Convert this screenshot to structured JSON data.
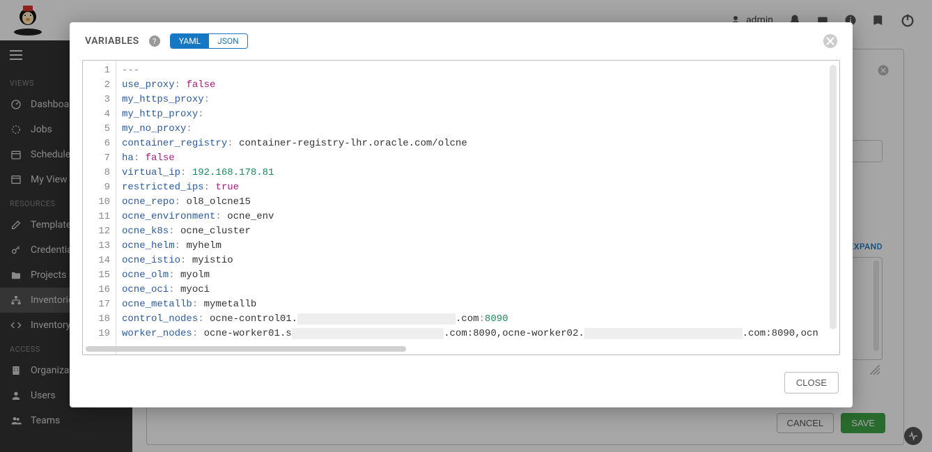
{
  "topbar": {
    "username": "admin"
  },
  "sidebar": {
    "sections": [
      {
        "label": "VIEWS",
        "items": [
          {
            "icon": "dashboard",
            "label": "Dashboard"
          },
          {
            "icon": "jobs",
            "label": "Jobs"
          },
          {
            "icon": "calendar",
            "label": "Schedules"
          },
          {
            "icon": "window",
            "label": "My View"
          }
        ]
      },
      {
        "label": "RESOURCES",
        "items": [
          {
            "icon": "edit",
            "label": "Templates"
          },
          {
            "icon": "key",
            "label": "Credentials"
          },
          {
            "icon": "folder",
            "label": "Projects"
          },
          {
            "icon": "sitemap",
            "label": "Inventories",
            "active": true
          },
          {
            "icon": "code",
            "label": "Inventory Scripts"
          }
        ]
      },
      {
        "label": "ACCESS",
        "items": [
          {
            "icon": "building",
            "label": "Organizations"
          },
          {
            "icon": "user",
            "label": "Users"
          },
          {
            "icon": "users",
            "label": "Teams"
          }
        ]
      }
    ]
  },
  "main": {
    "expand_label": "EXPAND",
    "cancel_label": "CANCEL",
    "save_label": "SAVE"
  },
  "modal": {
    "title": "VARIABLES",
    "mode_yaml": "YAML",
    "mode_json": "JSON",
    "close_label": "CLOSE",
    "editor_lines": [
      {
        "n": 1,
        "raw": "---"
      },
      {
        "n": 2,
        "key": "use_proxy",
        "val": "false",
        "type": "bool"
      },
      {
        "n": 3,
        "key": "my_https_proxy",
        "val": "",
        "type": "empty"
      },
      {
        "n": 4,
        "key": "my_http_proxy",
        "val": "",
        "type": "empty"
      },
      {
        "n": 5,
        "key": "my_no_proxy",
        "val": "",
        "type": "empty"
      },
      {
        "n": 6,
        "key": "container_registry",
        "val": "container-registry-lhr.oracle.com/olcne",
        "type": "str"
      },
      {
        "n": 7,
        "key": "ha",
        "val": "false",
        "type": "bool"
      },
      {
        "n": 8,
        "key": "virtual_ip",
        "val": "192.168.178.81",
        "type": "num"
      },
      {
        "n": 9,
        "key": "restricted_ips",
        "val": "true",
        "type": "bool"
      },
      {
        "n": 10,
        "key": "ocne_repo",
        "val": "ol8_olcne15",
        "type": "str"
      },
      {
        "n": 11,
        "key": "ocne_environment",
        "val": "ocne_env",
        "type": "str"
      },
      {
        "n": 12,
        "key": "ocne_k8s",
        "val": "ocne_cluster",
        "type": "str"
      },
      {
        "n": 13,
        "key": "ocne_helm",
        "val": "myhelm",
        "type": "str"
      },
      {
        "n": 14,
        "key": "ocne_istio",
        "val": "myistio",
        "type": "str"
      },
      {
        "n": 15,
        "key": "ocne_olm",
        "val": "myolm",
        "type": "str"
      },
      {
        "n": 16,
        "key": "ocne_oci",
        "val": "myoci",
        "type": "str"
      },
      {
        "n": 17,
        "key": "ocne_metallb",
        "val": "mymetallb",
        "type": "str"
      },
      {
        "n": 18,
        "key": "control_nodes",
        "val_prefix": "ocne-control01.",
        "val_suffix": ".com",
        "port": "8090",
        "type": "host"
      },
      {
        "n": 19,
        "key": "worker_nodes",
        "val_prefix": "ocne-worker01.s",
        "val_mid": ".com:8090,ocne-worker02.",
        "val_suffix": ".com:8090,ocn",
        "type": "host2"
      }
    ]
  }
}
